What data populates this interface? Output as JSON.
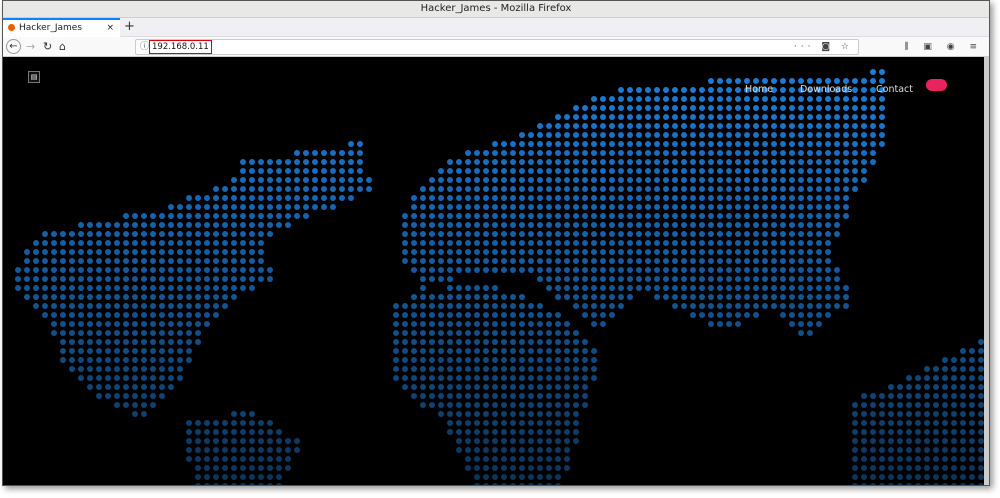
{
  "window": {
    "title": "Hacker_James - Mozilla Firefox"
  },
  "tab": {
    "label": "Hacker_James",
    "close": "×",
    "new_tab": "+"
  },
  "toolbar": {
    "back": "←",
    "forward": "→",
    "reload": "↻",
    "home": "⌂",
    "url": "192.168.0.11",
    "info": "ⓘ",
    "page_actions": "···",
    "pocket": "◙",
    "bookmark": "☆",
    "library": "⫼",
    "sidebar": "▣",
    "account": "◉",
    "menu": "≡"
  },
  "site": {
    "logo": "▤",
    "nav": [
      "Home",
      "Downloads",
      "Contact"
    ],
    "accent": "#e8245e",
    "dot_color": "#1e7fdc"
  }
}
